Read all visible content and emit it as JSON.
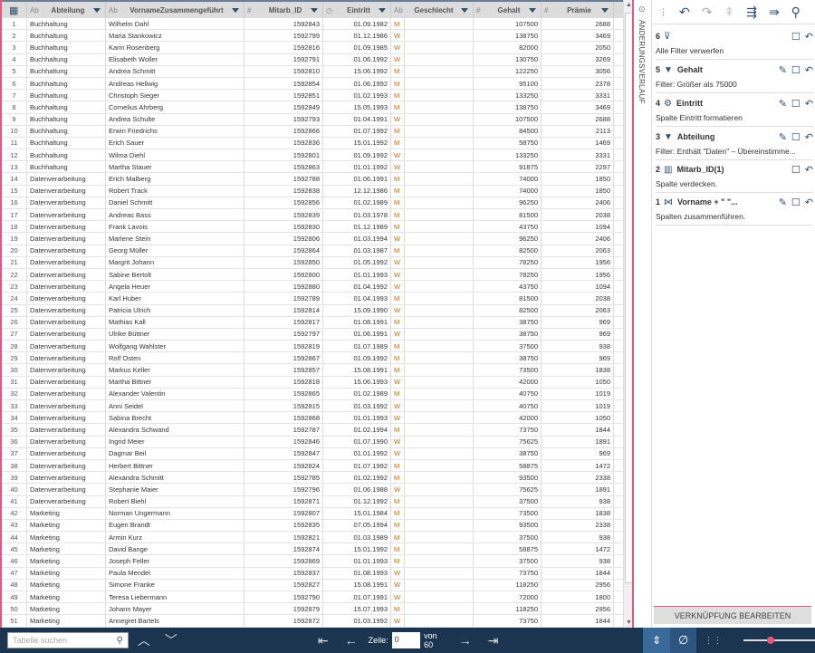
{
  "columns": [
    {
      "type": "",
      "label": ""
    },
    {
      "type": "Ab",
      "label": "Abteilung"
    },
    {
      "type": "Ab",
      "label": "VornameZusammengeführt"
    },
    {
      "type": "#",
      "label": "Mitarb_ID"
    },
    {
      "type": "◷",
      "label": "Eintritt"
    },
    {
      "type": "Ab",
      "label": "Geschlecht"
    },
    {
      "type": "#",
      "label": "Gehalt"
    },
    {
      "type": "#",
      "label": "Prämie"
    }
  ],
  "rows": [
    [
      "1",
      "Buchhaltung",
      "Wilhelm Dahl",
      "1592843",
      "01.09.1982",
      "M",
      "107500",
      "2688"
    ],
    [
      "2",
      "Buchhaltung",
      "Maria Stankowicz",
      "1592799",
      "01.12.1986",
      "W",
      "138750",
      "3469"
    ],
    [
      "3",
      "Buchhaltung",
      "Karin Rosenberg",
      "1592816",
      "01.09.1985",
      "W",
      "82000",
      "2050"
    ],
    [
      "4",
      "Buchhaltung",
      "Elisabeth Woller",
      "1592791",
      "01.06.1992",
      "W",
      "130750",
      "3269"
    ],
    [
      "5",
      "Buchhaltung",
      "Andrea Schmitt",
      "1592810",
      "15.06.1992",
      "M",
      "122250",
      "3056"
    ],
    [
      "6",
      "Buchhaltung",
      "Andreas Hellwig",
      "1592854",
      "01.06.1992",
      "M",
      "95100",
      "2378"
    ],
    [
      "7",
      "Buchhaltung",
      "Christoph Sieger",
      "1592851",
      "01.02.1993",
      "M",
      "133250",
      "3331"
    ],
    [
      "8",
      "Buchhaltung",
      "Cornelius Ahrberg",
      "1592849",
      "15.05.1993",
      "M",
      "138750",
      "3469"
    ],
    [
      "9",
      "Buchhaltung",
      "Andrea Schulte",
      "1592793",
      "01.04.1991",
      "W",
      "107500",
      "2688"
    ],
    [
      "10",
      "Buchhaltung",
      "Erwin Friedrichs",
      "1592866",
      "01.07.1992",
      "M",
      "84500",
      "2113"
    ],
    [
      "11",
      "Buchhaltung",
      "Erich Sauer",
      "1592836",
      "15.01.1992",
      "M",
      "58750",
      "1469"
    ],
    [
      "12",
      "Buchhaltung",
      "Wilma Diehl",
      "1592801",
      "01.09.1992",
      "W",
      "133250",
      "3331"
    ],
    [
      "13",
      "Buchhaltung",
      "Martha Stauer",
      "1592863",
      "01.01.1992",
      "W",
      "91875",
      "2297"
    ],
    [
      "14",
      "Datenverarbeitung",
      "Erich Malberg",
      "1592788",
      "01.06.1991",
      "M",
      "74000",
      "1850"
    ],
    [
      "15",
      "Datenverarbeitung",
      "Robert Track",
      "1592838",
      "12.12.1986",
      "M",
      "74000",
      "1850"
    ],
    [
      "16",
      "Datenverarbeitung",
      "Daniel Schmitt",
      "1592856",
      "01.02.1989",
      "M",
      "96250",
      "2406"
    ],
    [
      "17",
      "Datenverarbeitung",
      "Andreas Bass",
      "1592839",
      "01.03.1978",
      "M",
      "81500",
      "2038"
    ],
    [
      "18",
      "Datenverarbeitung",
      "Frank Lavois",
      "1592830",
      "01.12.1989",
      "M",
      "43750",
      "1094"
    ],
    [
      "19",
      "Datenverarbeitung",
      "Marlene Stein",
      "1592806",
      "01.03.1994",
      "W",
      "96250",
      "2406"
    ],
    [
      "20",
      "Datenverarbeitung",
      "Georg Müller",
      "1592864",
      "01.03.1987",
      "M",
      "82500",
      "2063"
    ],
    [
      "21",
      "Datenverarbeitung",
      "Margrit Johann",
      "1592850",
      "01.05.1992",
      "W",
      "78250",
      "1956"
    ],
    [
      "22",
      "Datenverarbeitung",
      "Sabine Bertolt",
      "1592800",
      "01.01.1993",
      "W",
      "78250",
      "1956"
    ],
    [
      "23",
      "Datenverarbeitung",
      "Angela Heuer",
      "1592880",
      "01.04.1992",
      "W",
      "43750",
      "1094"
    ],
    [
      "24",
      "Datenverarbeitung",
      "Karl Huber",
      "1592789",
      "01.04.1993",
      "M",
      "81500",
      "2038"
    ],
    [
      "25",
      "Datenverarbeitung",
      "Patricia Ulrich",
      "1592814",
      "15.09.1990",
      "W",
      "82500",
      "2063"
    ],
    [
      "26",
      "Datenverarbeitung",
      "Mathias Kall",
      "1592817",
      "01.08.1991",
      "M",
      "38750",
      "969"
    ],
    [
      "27",
      "Datenverarbeitung",
      "Ulrike Büttner",
      "1592797",
      "01.06.1991",
      "W",
      "38750",
      "969"
    ],
    [
      "28",
      "Datenverarbeitung",
      "Wolfgang Wahlster",
      "1592819",
      "01.07.1989",
      "M",
      "37500",
      "938"
    ],
    [
      "29",
      "Datenverarbeitung",
      "Rolf Osten",
      "1592867",
      "01.09.1992",
      "M",
      "38750",
      "969"
    ],
    [
      "30",
      "Datenverarbeitung",
      "Markus Keller",
      "1592857",
      "15.08.1991",
      "M",
      "73500",
      "1838"
    ],
    [
      "31",
      "Datenverarbeitung",
      "Martha Bittner",
      "1592818",
      "15.06.1993",
      "W",
      "42000",
      "1050"
    ],
    [
      "32",
      "Datenverarbeitung",
      "Alexander Valentin",
      "1592865",
      "01.02.1989",
      "M",
      "40750",
      "1019"
    ],
    [
      "33",
      "Datenverarbeitung",
      "Anni Seidel",
      "1592815",
      "01.03.1992",
      "W",
      "40750",
      "1019"
    ],
    [
      "34",
      "Datenverarbeitung",
      "Sabina Brecht",
      "1592868",
      "01.01.1993",
      "W",
      "42000",
      "1050"
    ],
    [
      "35",
      "Datenverarbeitung",
      "Alexandra Schwand",
      "1592787",
      "01.02.1994",
      "M",
      "73750",
      "1844"
    ],
    [
      "36",
      "Datenverarbeitung",
      "Ingrid Meier",
      "1592846",
      "01.07.1990",
      "W",
      "75625",
      "1891"
    ],
    [
      "37",
      "Datenverarbeitung",
      "Dagmar Beil",
      "1592847",
      "01.01.1992",
      "W",
      "38750",
      "969"
    ],
    [
      "38",
      "Datenverarbeitung",
      "Herbert Bittner",
      "1592824",
      "01.07.1992",
      "M",
      "58875",
      "1472"
    ],
    [
      "39",
      "Datenverarbeitung",
      "Alexandra Schmitt",
      "1592785",
      "01.02.1992",
      "M",
      "93500",
      "2338"
    ],
    [
      "40",
      "Datenverarbeitung",
      "Stephanie Maier",
      "1592796",
      "01.06.1988",
      "W",
      "75625",
      "1891"
    ],
    [
      "41",
      "Datenverarbeitung",
      "Robert Biehl",
      "1592871",
      "01.12.1992",
      "M",
      "37500",
      "938"
    ],
    [
      "42",
      "Marketing",
      "Norman Ungermann",
      "1592807",
      "15.01.1984",
      "M",
      "73500",
      "1838"
    ],
    [
      "43",
      "Marketing",
      "Eugen Brandt",
      "1592835",
      "07.05.1994",
      "M",
      "93500",
      "2338"
    ],
    [
      "44",
      "Marketing",
      "Armin Kurz",
      "1592821",
      "01.03.1989",
      "M",
      "37500",
      "938"
    ],
    [
      "45",
      "Marketing",
      "David Bange",
      "1592874",
      "15.01.1992",
      "M",
      "58875",
      "1472"
    ],
    [
      "46",
      "Marketing",
      "Joseph Feller",
      "1592869",
      "01.01.1993",
      "M",
      "37500",
      "938"
    ],
    [
      "47",
      "Marketing",
      "Paula Mendel",
      "1592837",
      "01.08.1993",
      "W",
      "73750",
      "1844"
    ],
    [
      "48",
      "Marketing",
      "Simone Franke",
      "1592827",
      "15.08.1991",
      "W",
      "118250",
      "2956"
    ],
    [
      "49",
      "Marketing",
      "Teresa Liebermann",
      "1592790",
      "01.07.1991",
      "W",
      "72000",
      "1800"
    ],
    [
      "50",
      "Marketing",
      "Johann Mayer",
      "1592879",
      "15.07.1993",
      "M",
      "118250",
      "2956"
    ],
    [
      "51",
      "Marketing",
      "Annegret Bartels",
      "1592872",
      "01.03.1992",
      "W",
      "73750",
      "1844"
    ]
  ],
  "panel": {
    "tab_label": "ÄNDERUNGSVERLAUF",
    "entries": [
      {
        "n": "6",
        "icon": "clear-filter-icon",
        "title": "",
        "desc": "Alle Filter verwerfen",
        "edit": false
      },
      {
        "n": "5",
        "icon": "filter-icon",
        "title": "Gehalt",
        "desc": "Filter: Größer als 75000",
        "edit": true
      },
      {
        "n": "4",
        "icon": "format-column-icon",
        "title": "Eintritt",
        "desc": "Spalte Eintritt formatieren",
        "edit": true
      },
      {
        "n": "3",
        "icon": "filter-icon",
        "title": "Abteilung",
        "desc": "Filter: Enthält \"Daten\" – Übereinstimme...",
        "edit": true
      },
      {
        "n": "2",
        "icon": "hide-column-icon",
        "title": "Mitarb_ID(1)",
        "desc": "Spalte verdecken.",
        "edit": false
      },
      {
        "n": "1",
        "icon": "merge-columns-icon",
        "title": "Vorname + \" \"...",
        "desc": "Spalten zusammenführen.",
        "edit": true
      }
    ],
    "link_button": "VERKNÜPFUNG BEARBEITEN"
  },
  "bottom": {
    "search_placeholder": "Tabelle suchen",
    "row_label": "Zeile:",
    "row_value": "0",
    "of_label": "von 60",
    "zoom_level": 0.37
  },
  "colors": {
    "accent": "#e8577a",
    "bar": "#1b3550",
    "icon": "#2c4f73"
  }
}
